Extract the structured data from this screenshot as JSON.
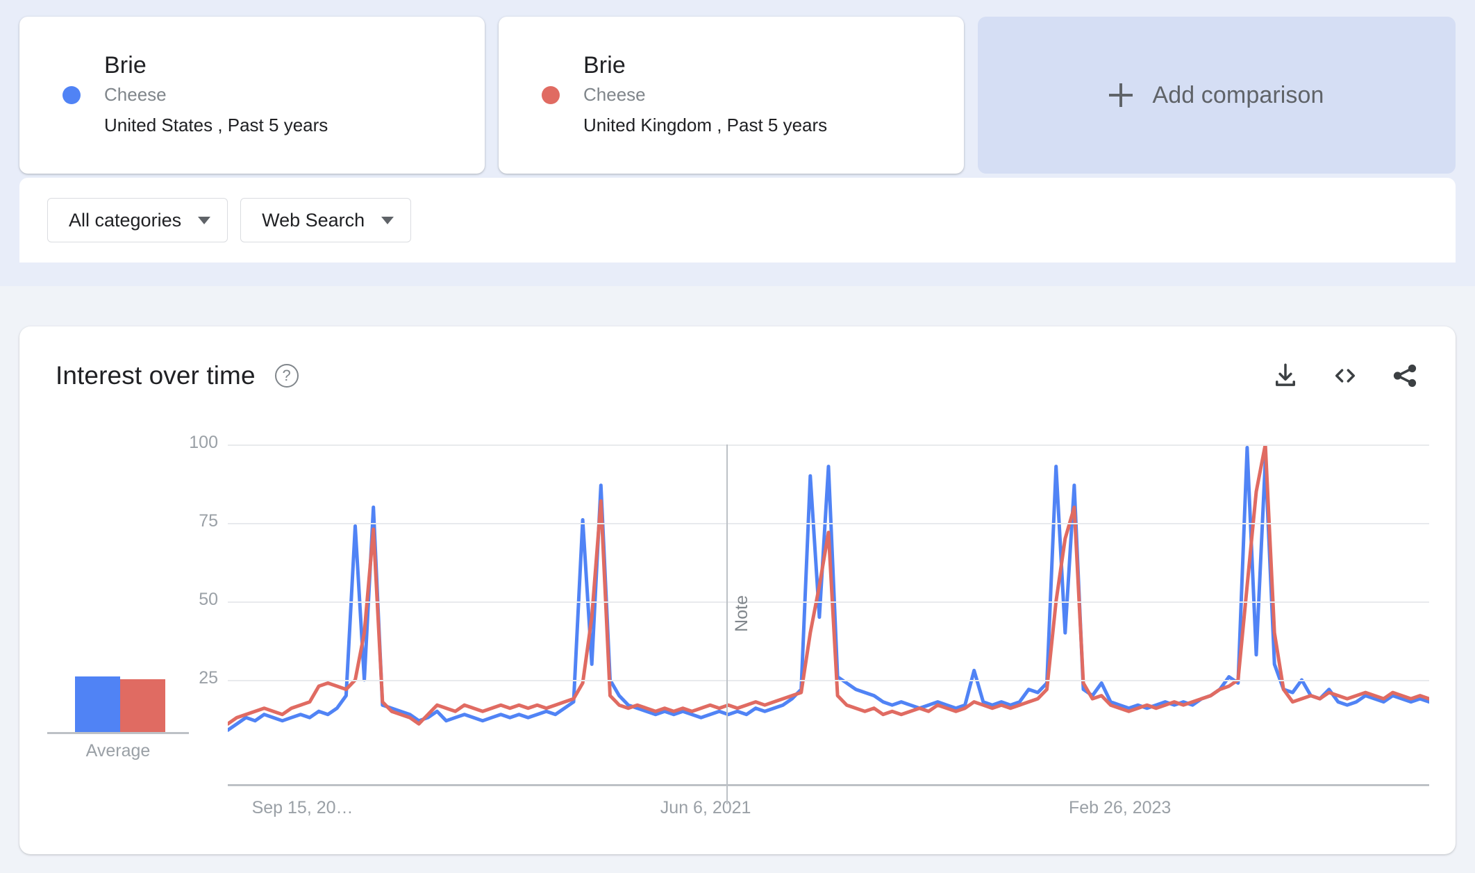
{
  "colors": {
    "series_a": "#5083f5",
    "series_b": "#e06b62",
    "page_bg_top": "#e8edf9",
    "page_bg": "#f0f3f8",
    "add_card_bg": "#d5def4",
    "text_primary": "#202124",
    "text_secondary": "#80868b",
    "grid": "#e8eaed"
  },
  "comparison": {
    "cards": [
      {
        "term": "Brie",
        "category": "Cheese",
        "meta": "United States , Past 5 years",
        "dot_color": "#5083f5"
      },
      {
        "term": "Brie",
        "category": "Cheese",
        "meta": "United Kingdom , Past 5 years",
        "dot_color": "#e06b62"
      }
    ],
    "add_button": {
      "label": "Add comparison",
      "icon": "plus-icon"
    }
  },
  "filters": {
    "category": {
      "label": "All categories",
      "icon": "chevron-down-icon"
    },
    "search_type": {
      "label": "Web Search",
      "icon": "chevron-down-icon"
    }
  },
  "panel": {
    "title": "Interest over time",
    "help_icon": "help-circle-icon",
    "help_glyph": "?",
    "actions": [
      {
        "name": "download-icon",
        "tooltip": "Download"
      },
      {
        "name": "embed-code-icon",
        "tooltip": "Embed"
      },
      {
        "name": "share-icon",
        "tooltip": "Share"
      }
    ]
  },
  "chart_data": {
    "type": "line",
    "title": "Interest over time",
    "xlabel": "",
    "ylabel": "",
    "ylim": [
      0,
      100
    ],
    "yticks": [
      100,
      75,
      50,
      25
    ],
    "xticks": [
      "Sep 15, 20…",
      "Jun 6, 2021",
      "Feb 26, 2023"
    ],
    "xtick_positions_pct": [
      2,
      36,
      70
    ],
    "grid": true,
    "legend_position": "cards-above",
    "annotations": [
      {
        "label": "Note",
        "x_pct": 41.5,
        "type": "vertical-line"
      }
    ],
    "average_bars": {
      "label": "Average",
      "values": [
        17,
        16
      ],
      "colors": [
        "#5083f5",
        "#e06b62"
      ]
    },
    "series": [
      {
        "name": "Brie - United States",
        "color": "#5083f5",
        "values": [
          9,
          11,
          13,
          12,
          14,
          13,
          12,
          13,
          14,
          13,
          15,
          14,
          16,
          20,
          74,
          25,
          80,
          17,
          16,
          15,
          14,
          12,
          13,
          15,
          12,
          13,
          14,
          13,
          12,
          13,
          14,
          13,
          14,
          13,
          14,
          15,
          14,
          16,
          18,
          76,
          30,
          87,
          25,
          20,
          17,
          16,
          15,
          14,
          15,
          14,
          15,
          14,
          13,
          14,
          15,
          14,
          15,
          14,
          16,
          15,
          16,
          17,
          19,
          22,
          90,
          45,
          93,
          26,
          24,
          22,
          21,
          20,
          18,
          17,
          18,
          17,
          16,
          17,
          18,
          17,
          16,
          17,
          28,
          18,
          17,
          18,
          17,
          18,
          22,
          21,
          24,
          93,
          40,
          87,
          22,
          20,
          24,
          18,
          17,
          16,
          17,
          16,
          17,
          18,
          17,
          18,
          17,
          19,
          20,
          22,
          26,
          24,
          99,
          33,
          95,
          30,
          22,
          21,
          25,
          20,
          19,
          22,
          18,
          17,
          18,
          20,
          19,
          18,
          20,
          19,
          18,
          19,
          18
        ]
      },
      {
        "name": "Brie - United Kingdom",
        "color": "#e06b62",
        "values": [
          11,
          13,
          14,
          15,
          16,
          15,
          14,
          16,
          17,
          18,
          23,
          24,
          23,
          22,
          25,
          40,
          73,
          18,
          15,
          14,
          13,
          11,
          14,
          17,
          16,
          15,
          17,
          16,
          15,
          16,
          17,
          16,
          17,
          16,
          17,
          16,
          17,
          18,
          19,
          24,
          45,
          82,
          20,
          17,
          16,
          17,
          16,
          15,
          16,
          15,
          16,
          15,
          16,
          17,
          16,
          17,
          16,
          17,
          18,
          17,
          18,
          19,
          20,
          21,
          40,
          55,
          72,
          20,
          17,
          16,
          15,
          16,
          14,
          15,
          14,
          15,
          16,
          15,
          17,
          16,
          15,
          16,
          18,
          17,
          16,
          17,
          16,
          17,
          18,
          19,
          22,
          50,
          70,
          80,
          24,
          19,
          20,
          17,
          16,
          15,
          16,
          17,
          16,
          17,
          18,
          17,
          18,
          19,
          20,
          22,
          23,
          25,
          55,
          85,
          100,
          40,
          22,
          18,
          19,
          20,
          19,
          21,
          20,
          19,
          20,
          21,
          20,
          19,
          21,
          20,
          19,
          20,
          19
        ]
      }
    ]
  }
}
